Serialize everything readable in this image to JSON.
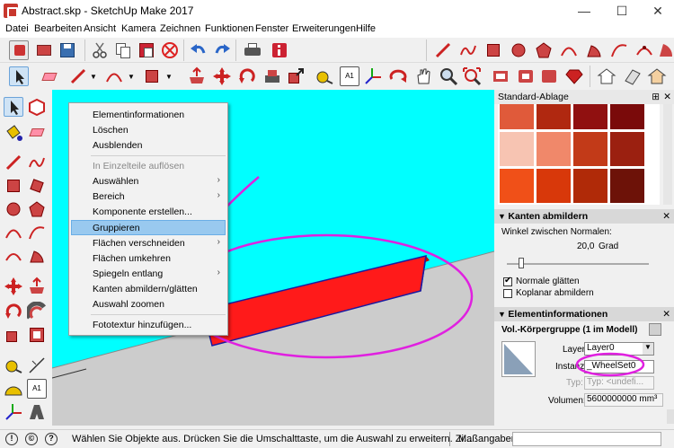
{
  "window": {
    "title": "Abstract.skp - SketchUp Make 2017",
    "min": "—",
    "max": "☐",
    "close": "✕"
  },
  "menu": [
    "Datei",
    "Bearbeiten",
    "Ansicht",
    "Kamera",
    "Zeichnen",
    "Funktionen",
    "Fenster",
    "Erweiterungen",
    "Hilfe"
  ],
  "context_menu": {
    "items": [
      {
        "label": "Elementinformationen",
        "enabled": true,
        "submenu": false
      },
      {
        "label": "Löschen",
        "enabled": true,
        "submenu": false
      },
      {
        "label": "Ausblenden",
        "enabled": true,
        "submenu": false
      },
      {
        "label": "In Einzelteile auflösen",
        "enabled": false,
        "submenu": false
      },
      {
        "label": "Auswählen",
        "enabled": true,
        "submenu": true
      },
      {
        "label": "Bereich",
        "enabled": true,
        "submenu": true
      },
      {
        "label": "Komponente erstellen...",
        "enabled": true,
        "submenu": false
      },
      {
        "label": "Gruppieren",
        "enabled": true,
        "submenu": false,
        "highlighted": true
      },
      {
        "label": "Flächen verschneiden",
        "enabled": true,
        "submenu": true
      },
      {
        "label": "Flächen umkehren",
        "enabled": true,
        "submenu": false
      },
      {
        "label": "Spiegeln entlang",
        "enabled": true,
        "submenu": true
      },
      {
        "label": "Kanten abmildern/glätten",
        "enabled": true,
        "submenu": false
      },
      {
        "label": "Auswahl zoomen",
        "enabled": true,
        "submenu": false
      },
      {
        "label": "Fototextur hinzufügen...",
        "enabled": true,
        "submenu": false
      }
    ]
  },
  "panel": {
    "tray_title": "Standard-Ablage",
    "swatch_colors": [
      "#e05a3a",
      "#b02810",
      "#901010",
      "#7a0a0a",
      "#f7c4b2",
      "#f0886a",
      "#c23a18",
      "#9b2010",
      "#f05018",
      "#d8380a",
      "#b02a08",
      "#6d1208",
      "#fbd0b8",
      "#e8a890",
      "#d07858",
      "#8a3018"
    ],
    "soften": {
      "title": "Kanten abmildern",
      "angle_label": "Winkel zwischen Normalen:",
      "angle_value": "20,0",
      "angle_unit": "Grad",
      "smooth_label": "Normale glätten",
      "smooth_checked": true,
      "coplanar_label": "Koplanar abmildern",
      "coplanar_checked": false,
      "slider_value": 0.1
    },
    "entity": {
      "title": "Elementinformationen",
      "subtitle": "Vol.-Körpergruppe (1 im Modell)",
      "layer_label": "Layer:",
      "layer_value": "Layer0",
      "instance_label": "Instanz:",
      "instance_value": "_WheelSet0",
      "type_label": "Typ:",
      "type_value": "Typ: <undefi...",
      "volume_label": "Volumen:",
      "volume_value": "5600000000 mm³"
    }
  },
  "status": {
    "message": "Wählen Sie Objekte aus. Drücken Sie die Umschalttaste, um die Auswahl zu erweitern. Zi...",
    "measure_label": "Maßangaben"
  },
  "colors": {
    "sky": "#00ffff",
    "ground": "#cccccc",
    "block": "#ff1a1a",
    "annotation": "#e020e0",
    "menu_highlight": "#99c9ef"
  }
}
